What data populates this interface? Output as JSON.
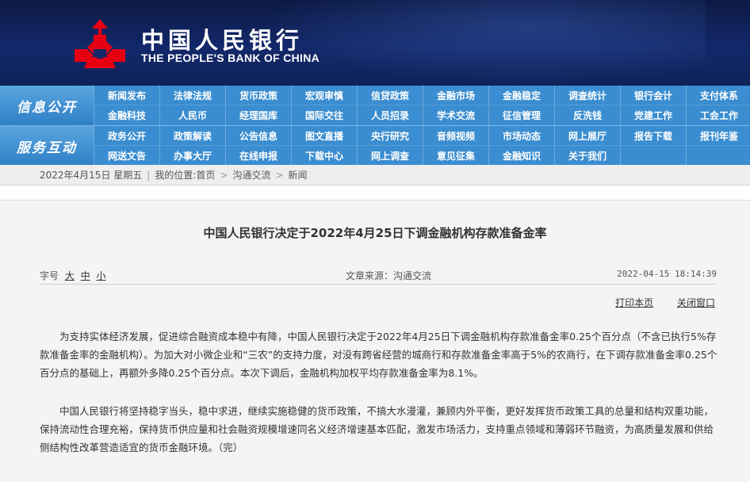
{
  "header": {
    "logo_cn": "中国人民银行",
    "logo_en": "THE PEOPLE'S BANK OF CHINA",
    "brand_red": "#e60012"
  },
  "nav": {
    "public": {
      "label": "信息公开",
      "items": [
        "新闻发布",
        "法律法规",
        "货币政策",
        "宏观审慎",
        "信贷政策",
        "金融市场",
        "金融稳定",
        "调查统计",
        "银行会计",
        "支付体系",
        "金融科技",
        "人民币",
        "经理国库",
        "国际交往",
        "人员招录",
        "学术交流",
        "征信管理",
        "反洗钱",
        "党建工作",
        "工会工作"
      ]
    },
    "service": {
      "label": "服务互动",
      "items": [
        "政务公开",
        "政策解读",
        "公告信息",
        "图文直播",
        "央行研究",
        "音频视频",
        "市场动态",
        "网上展厅",
        "报告下载",
        "报刊年鉴",
        "网送文告",
        "办事大厅",
        "在线申报",
        "下载中心",
        "网上调查",
        "意见征集",
        "金融知识",
        "关于我们",
        "",
        ""
      ]
    }
  },
  "breadcrumb": {
    "date": "2022年4月15日 星期五",
    "location_label": "我的位置:",
    "home": "首页",
    "section": "沟通交流",
    "current": "新闻",
    "sep": ">"
  },
  "article": {
    "title": "中国人民银行决定于2022年4月25日下调金融机构存款准备金率",
    "font_size_label": "字号",
    "size_large": "大",
    "size_medium": "中",
    "size_small": "小",
    "source": "文章来源：沟通交流",
    "datetime": "2022-04-15  18:14:39",
    "print": "打印本页",
    "close": "关闭窗口",
    "paragraphs": [
      "为支持实体经济发展，促进综合融资成本稳中有降，中国人民银行决定于2022年4月25日下调金融机构存款准备金率0.25个百分点（不含已执行5%存款准备金率的金融机构）。为加大对小微企业和“三农”的支持力度，对没有跨省经营的城商行和存款准备金率高于5%的农商行，在下调存款准备金率0.25个百分点的基础上，再额外多降0.25个百分点。本次下调后，金融机构加权平均存款准备金率为8.1%。",
      "中国人民银行将坚持稳字当头，稳中求进，继续实施稳健的货币政策，不搞大水漫灌，兼顾内外平衡，更好发挥货币政策工具的总量和结构双重功能，保持流动性合理充裕，保持货币供应量和社会融资规模增速同名义经济增速基本匹配，激发市场活力，支持重点领域和薄弱环节融资，为高质量发展和供给侧结构性改革营造适宜的货币金融环境。（完）"
    ]
  }
}
